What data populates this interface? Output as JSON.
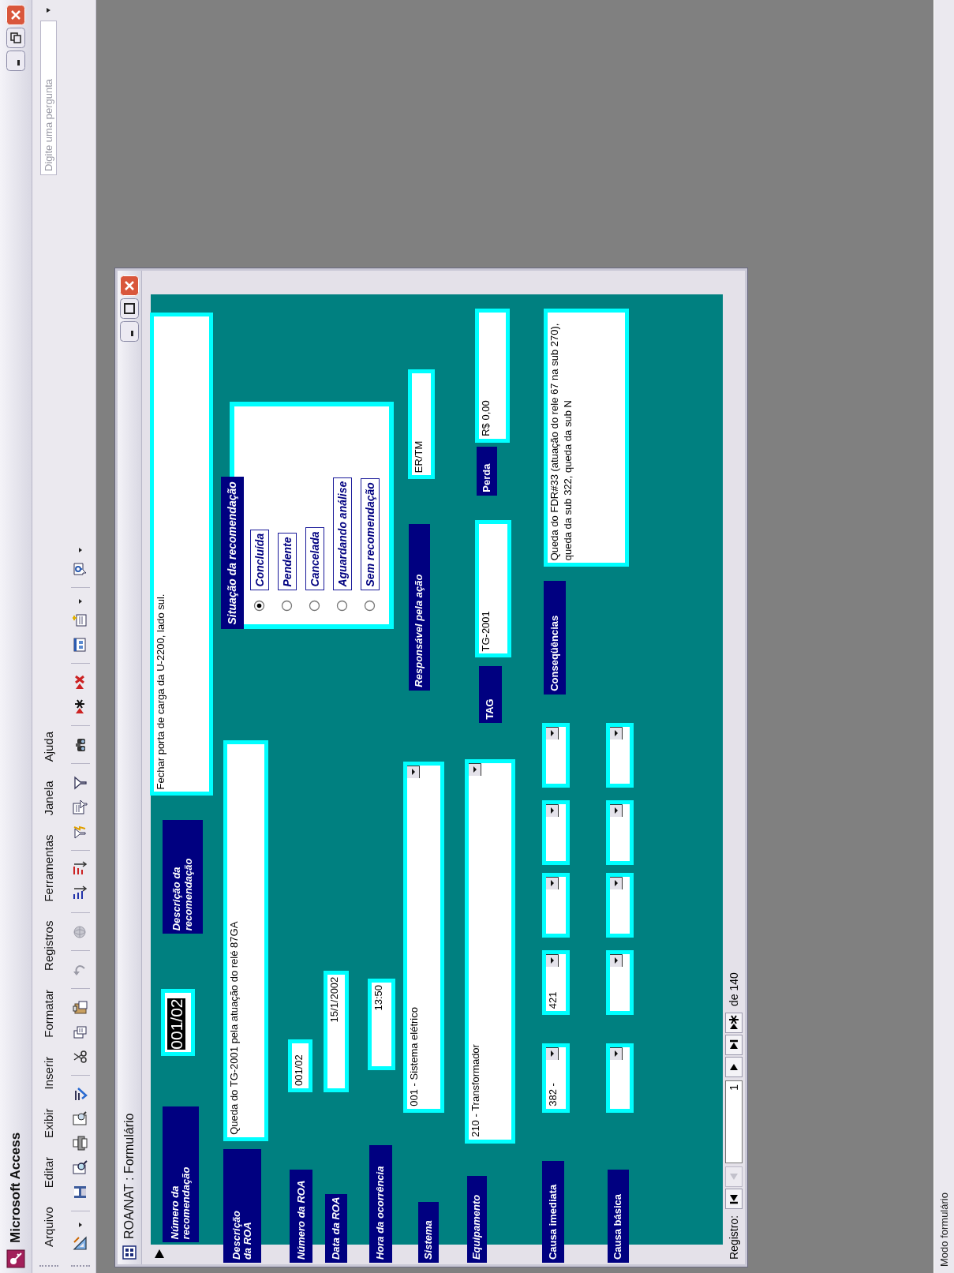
{
  "window": {
    "title": "Microsoft Access"
  },
  "menu": [
    "Arquivo",
    "Editar",
    "Exibir",
    "Inserir",
    "Formatar",
    "Registros",
    "Ferramentas",
    "Janela",
    "Ajuda"
  ],
  "help_box": {
    "placeholder": "Digite uma pergunta"
  },
  "form_window": {
    "title": "ROA/NAT : Formulário",
    "controls": [
      {
        "kind": "label",
        "text": "Número da recomendação",
        "italic": true
      },
      {
        "kind": "text",
        "value": "001/02",
        "highlighted": true
      },
      {
        "kind": "label",
        "text": "Descrição da recomendação",
        "italic": true
      },
      {
        "kind": "text",
        "value": "Fechar porta de carga da U-2200, lado sul.",
        "highlighted": false
      },
      {
        "kind": "label",
        "text": "Descrição da ROA",
        "italic": true
      },
      {
        "kind": "text",
        "value": "Queda do TG-2001 pela atuação do relé 87GA",
        "highlighted": false
      },
      {
        "kind": "label",
        "text": "Número da ROA",
        "italic": true
      },
      {
        "kind": "text",
        "value": "001/02",
        "highlighted": false
      },
      {
        "kind": "label",
        "text": "Data da ROA",
        "italic": true
      },
      {
        "kind": "text",
        "value": "15/1/2002",
        "highlighted": false
      },
      {
        "kind": "label",
        "text": "Hora da ocorrência",
        "italic": true
      },
      {
        "kind": "text",
        "value": "13:50",
        "highlighted": false
      },
      {
        "kind": "label",
        "text": "Sistema",
        "italic": true
      },
      {
        "kind": "combo",
        "value": "001 - Sistema elétrico",
        "highlighted": false
      },
      {
        "kind": "label",
        "text": "Equipamento",
        "italic": true
      },
      {
        "kind": "combo",
        "value": "210 - Transformador",
        "highlighted": false
      },
      {
        "kind": "label",
        "text": "Causa imediata",
        "italic": false
      },
      {
        "kind": "combo",
        "value": "382 -",
        "highlighted": false
      },
      {
        "kind": "combo",
        "value": "421",
        "highlighted": false
      },
      {
        "kind": "combo"
      },
      {
        "kind": "combo"
      },
      {
        "kind": "combo"
      },
      {
        "kind": "label",
        "text": "Causa básica",
        "italic": false
      },
      {
        "kind": "combo"
      },
      {
        "kind": "combo"
      },
      {
        "kind": "combo"
      },
      {
        "kind": "combo"
      },
      {
        "kind": "combo"
      },
      {
        "kind": "option_group",
        "label": "Situação da recomendação",
        "options": [
          {
            "label": "Concluída",
            "selected": true
          },
          {
            "label": "Pendente",
            "selected": false
          },
          {
            "label": "Cancelada",
            "selected": false
          },
          {
            "label": "Aguardando análise",
            "selected": false
          },
          {
            "label": "Sem recomendação",
            "selected": false
          }
        ]
      },
      {
        "kind": "label",
        "text": "Responsável pela ação",
        "italic": true
      },
      {
        "kind": "text",
        "value": "ER/TM",
        "highlighted": false
      },
      {
        "kind": "label",
        "text": "TAG",
        "italic": false
      },
      {
        "kind": "text",
        "value": "TG-2001",
        "highlighted": false
      },
      {
        "kind": "label",
        "text": "Perda",
        "italic": false
      },
      {
        "kind": "text",
        "value": "R$ 0,00",
        "highlighted": false
      },
      {
        "kind": "label",
        "text": "Conseqüências",
        "italic": false
      },
      {
        "kind": "memo",
        "value": "Queda do FDR#33 (atuação do rele 67 na sub 270), queda da sub 322, queda da sub N",
        "highlighted": false
      }
    ],
    "navigation": {
      "label": "Registro:",
      "record": "1",
      "total": "de 140",
      "buttons": [
        {
          "kind": "first",
          "disabled": false
        },
        {
          "kind": "previous",
          "disabled": true
        },
        {
          "kind": "next",
          "disabled": false
        },
        {
          "kind": "last",
          "disabled": false
        },
        {
          "kind": "new",
          "disabled": false
        }
      ]
    }
  },
  "status_bar": "Modo formulário"
}
